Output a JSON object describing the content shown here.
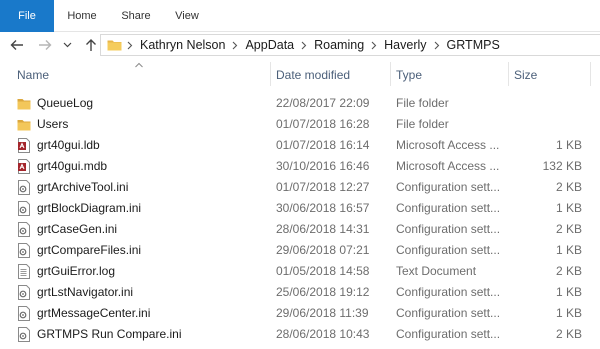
{
  "ribbon": {
    "tabs": [
      "File",
      "Home",
      "Share",
      "View"
    ]
  },
  "address": {
    "crumbs": [
      "Kathryn Nelson",
      "AppData",
      "Roaming",
      "Haverly",
      "GRTMPS"
    ]
  },
  "columns": {
    "name": "Name",
    "date": "Date modified",
    "type": "Type",
    "size": "Size"
  },
  "files": [
    {
      "name": "QueueLog",
      "date": "22/08/2017 22:09",
      "type": "File folder",
      "size": "",
      "icon": "folder-icon"
    },
    {
      "name": "Users",
      "date": "01/07/2018 16:28",
      "type": "File folder",
      "size": "",
      "icon": "folder-icon"
    },
    {
      "name": "grt40gui.ldb",
      "date": "01/07/2018 16:14",
      "type": "Microsoft Access ...",
      "size": "1 KB",
      "icon": "access-lock-file-icon"
    },
    {
      "name": "grt40gui.mdb",
      "date": "30/10/2016 16:46",
      "type": "Microsoft Access ...",
      "size": "132 KB",
      "icon": "access-database-icon"
    },
    {
      "name": "grtArchiveTool.ini",
      "date": "01/07/2018 12:27",
      "type": "Configuration sett...",
      "size": "2 KB",
      "icon": "config-file-icon"
    },
    {
      "name": "grtBlockDiagram.ini",
      "date": "30/06/2018 16:57",
      "type": "Configuration sett...",
      "size": "1 KB",
      "icon": "config-file-icon"
    },
    {
      "name": "grtCaseGen.ini",
      "date": "28/06/2018 14:31",
      "type": "Configuration sett...",
      "size": "2 KB",
      "icon": "config-file-icon"
    },
    {
      "name": "grtCompareFiles.ini",
      "date": "29/06/2018 07:21",
      "type": "Configuration sett...",
      "size": "1 KB",
      "icon": "config-file-icon"
    },
    {
      "name": "grtGuiError.log",
      "date": "01/05/2018 14:58",
      "type": "Text Document",
      "size": "2 KB",
      "icon": "text-document-icon"
    },
    {
      "name": "grtLstNavigator.ini",
      "date": "25/06/2018 19:12",
      "type": "Configuration sett...",
      "size": "1 KB",
      "icon": "config-file-icon"
    },
    {
      "name": "grtMessageCenter.ini",
      "date": "29/06/2018 11:39",
      "type": "Configuration sett...",
      "size": "1 KB",
      "icon": "config-file-icon"
    },
    {
      "name": "GRTMPS Run Compare.ini",
      "date": "28/06/2018 10:43",
      "type": "Configuration sett...",
      "size": "2 KB",
      "icon": "config-file-icon"
    }
  ],
  "colors": {
    "file_tab": "#1979ca",
    "folder": "#e8b64a",
    "access": "#a4262c",
    "header_text": "#4c607a"
  }
}
